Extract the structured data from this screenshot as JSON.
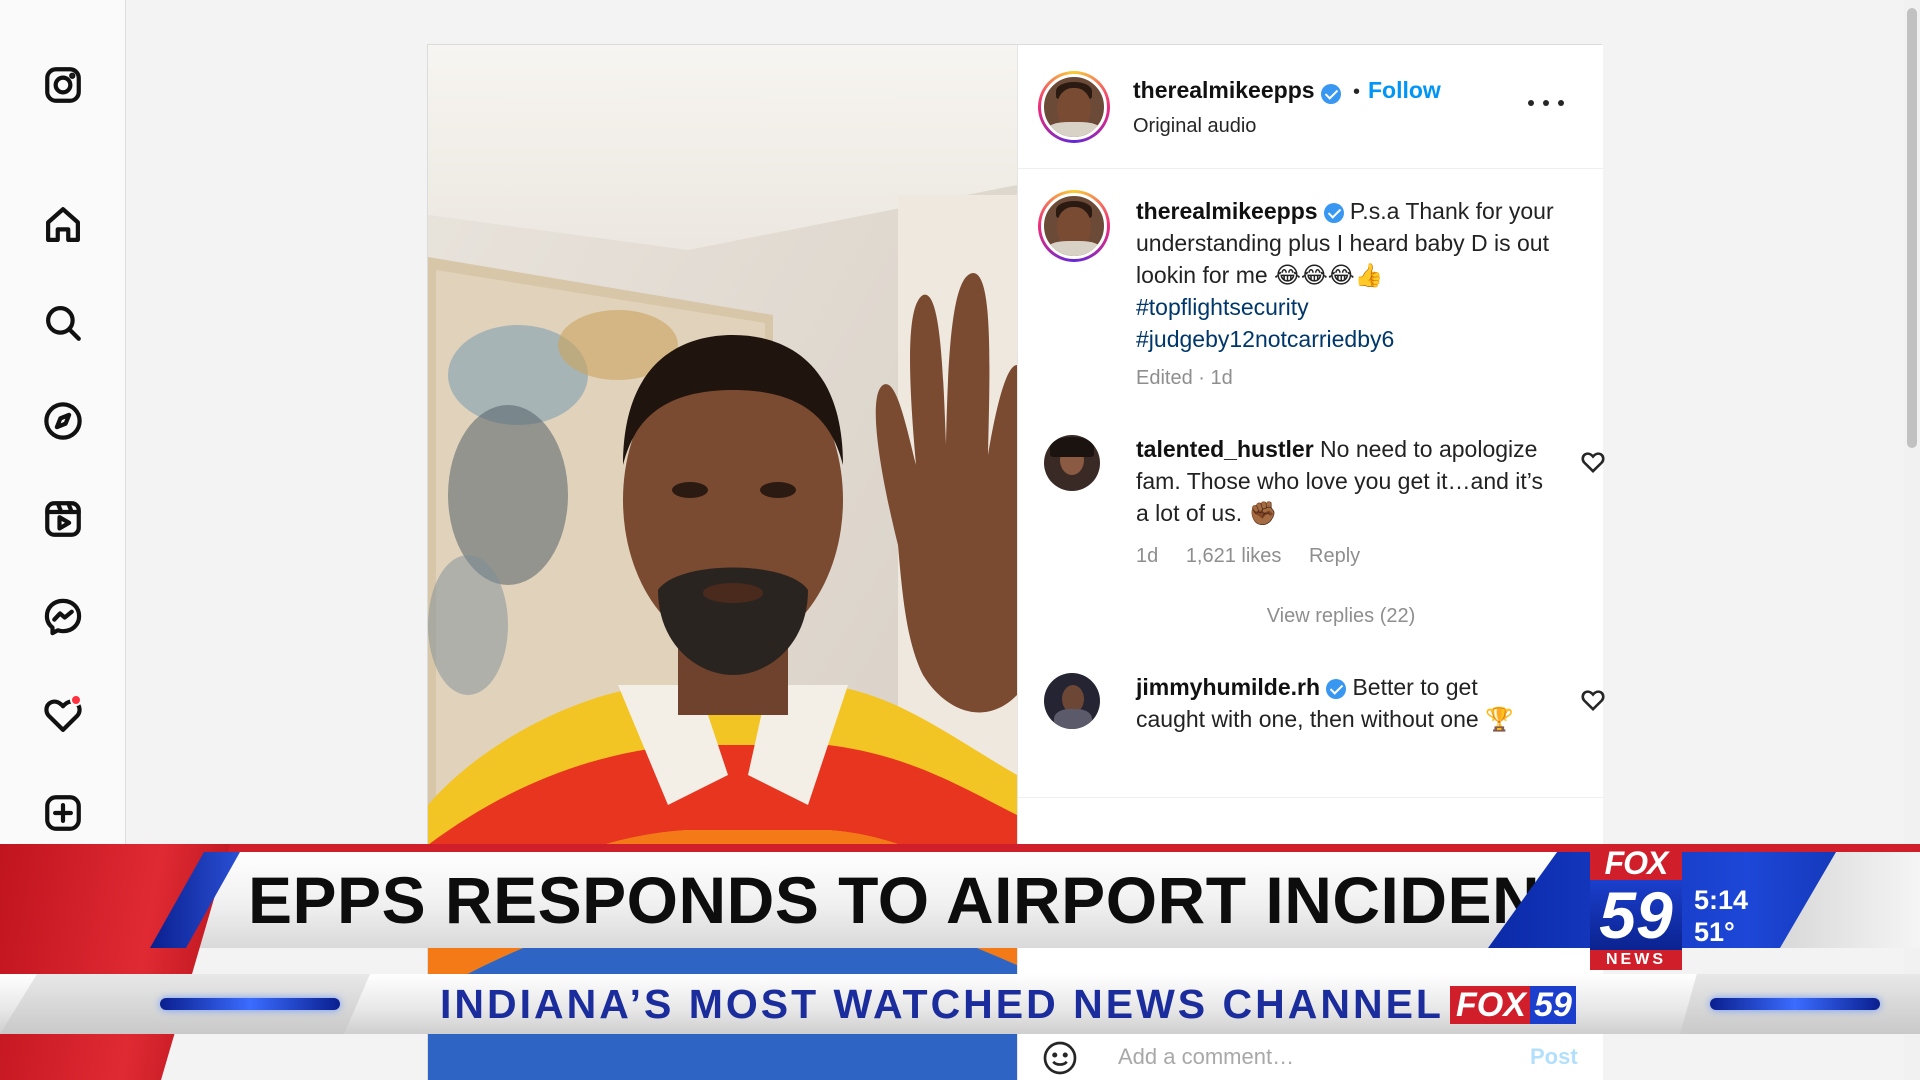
{
  "post": {
    "author": "therealmikeepps",
    "follow_label": "Follow",
    "separator": "•",
    "audio": "Original audio",
    "more_icon": "more-horizontal-icon",
    "caption_user": "therealmikeepps",
    "caption_text": "P.s.a Thank for your understanding plus I heard baby D is out lookin for me 😂😂😂👍",
    "hashtag1": "#topflightsecurity",
    "hashtag2": "#judgeby12notcarriedby6",
    "caption_meta": "Edited · 1d",
    "comments": [
      {
        "user": "talented_hustler",
        "text": "No need to apologize fam. Those who love you get it…and it’s a lot of us. ✊🏾",
        "time": "1d",
        "likes": "1,621 likes",
        "reply": "Reply",
        "view_replies": "View replies (22)"
      },
      {
        "user": "jimmyhumilde.rh",
        "text": "Better to get caught with one, then without one 🏆"
      }
    ],
    "add_comment_placeholder": "Add a comment…",
    "post_label": "Post"
  },
  "sidebar": {
    "icons": [
      "instagram-icon",
      "home-icon",
      "search-icon",
      "explore-icon",
      "reels-icon",
      "messenger-icon",
      "notifications-icon",
      "create-icon"
    ]
  },
  "broadcast": {
    "headline": "EPPS RESPONDS TO AIRPORT INCIDENT",
    "logo_fox": "FOX",
    "logo_num": "59",
    "logo_news": "NEWS",
    "time": "5:14",
    "temp": "51°",
    "ticker": "INDIANA’S MOST WATCHED NEWS CHANNEL",
    "ticker_logo_fox": "FOX",
    "ticker_logo_num": "59"
  },
  "colors": {
    "accent_blue": "#0095f6",
    "fox_red": "#d01f2a",
    "fox_blue": "#1b3fcc"
  }
}
